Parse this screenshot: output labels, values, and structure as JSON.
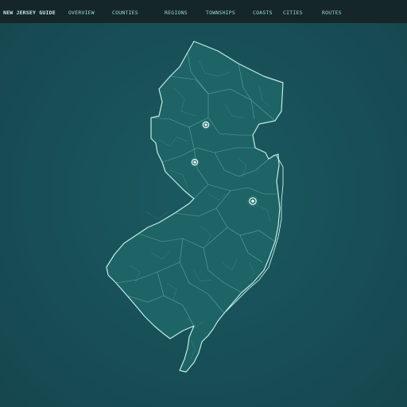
{
  "nav": {
    "brand": "NEW JERSEY GUIDE",
    "items": [
      "OVERVIEW",
      "COUNTIES",
      "REGIONS",
      "TOWNSHIPS",
      "COASTS",
      "CITIES",
      "ROUTES"
    ]
  },
  "map": {
    "region": "New Jersey",
    "markers": [
      "marker-north",
      "marker-central",
      "marker-east"
    ]
  },
  "colors": {
    "background": "#184f57",
    "topbar": "#142628",
    "land": "#1e6466",
    "outline": "#bfeee6",
    "nav_text": "#9fd7d6"
  },
  "icons": {
    "marker": "map-pin-icon"
  }
}
